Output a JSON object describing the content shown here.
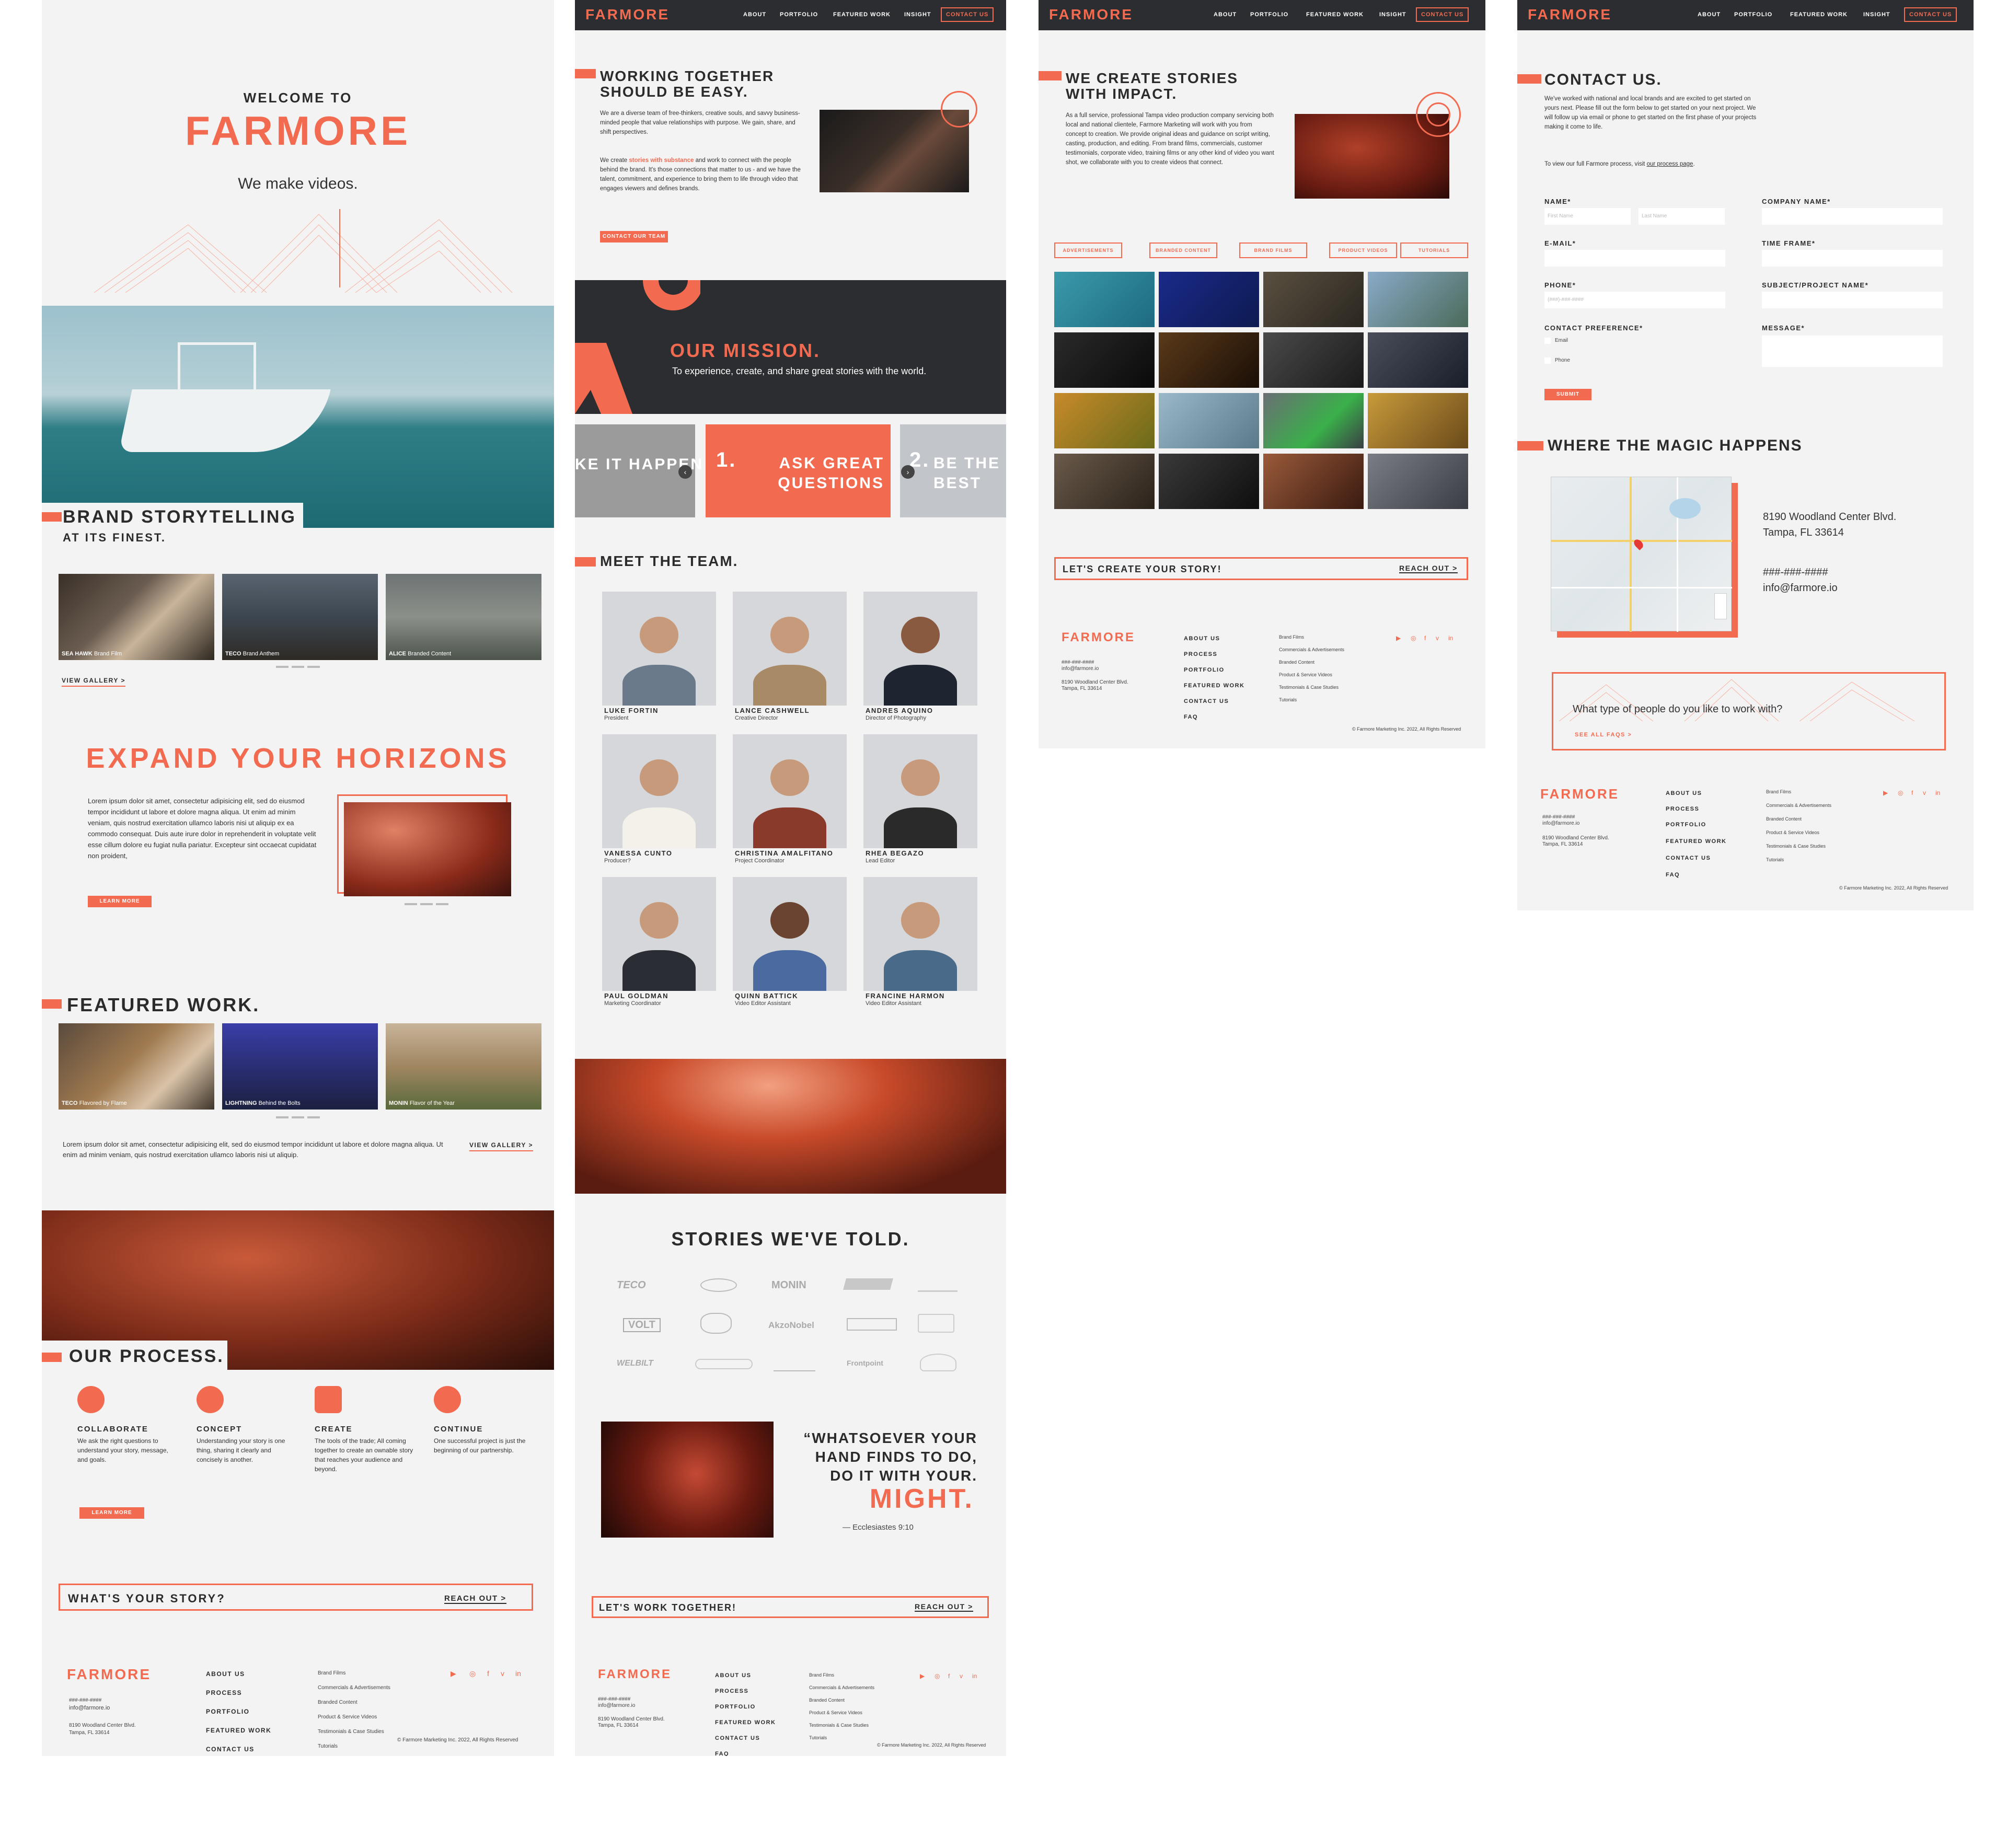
{
  "brand": "FARMORE",
  "colors": {
    "accent": "#f26b50",
    "dark": "#2b2d30",
    "bg": "#f3f3f3"
  },
  "nav": {
    "about": "ABOUT",
    "portfolio": "PORTFOLIO",
    "featured": "FEATURED WORK",
    "insight": "INSIGHT",
    "contact": "CONTACT US"
  },
  "home": {
    "welcome": "WELCOME TO",
    "tagline": "We make videos.",
    "brand_title_1": "BRAND STORYTELLING",
    "brand_title_2": "AT ITS FINEST.",
    "films": [
      {
        "name": "SEA HAWK",
        "type": "Brand Film"
      },
      {
        "name": "TECO",
        "type": "Brand Anthem"
      },
      {
        "name": "ALICE",
        "type": "Branded Content"
      }
    ],
    "view_gallery": "VIEW GALLERY >",
    "expand": "EXPAND YOUR HORIZONS",
    "lorem": "Lorem ipsum dolor sit amet, consectetur adipisicing elit, sed do eiusmod tempor incididunt ut labore et dolore magna aliqua. Ut enim ad minim veniam, quis nostrud exercitation ullamco laboris nisi ut aliquip ex ea commodo consequat. Duis aute irure dolor in reprehenderit in voluptate velit esse cillum dolore eu fugiat nulla pariatur. Excepteur sint occaecat cupidatat non proident,",
    "learn_more": "LEARN MORE",
    "featured_title": "FEATURED WORK.",
    "featured": [
      {
        "name": "TECO",
        "type": "Flavored by Flame"
      },
      {
        "name": "LIGHTNING",
        "type": "Behind the Bolts"
      },
      {
        "name": "MONIN",
        "type": "Flavor of the Year"
      }
    ],
    "featured_text": "Lorem ipsum dolor sit amet, consectetur adipisicing elit, sed do eiusmod tempor incididunt ut labore et dolore magna aliqua. Ut enim ad minim veniam, quis nostrud exercitation ullamco laboris nisi ut aliquip.",
    "view_gallery2": "VIEW GALLERY >",
    "process_title": "OUR PROCESS.",
    "process": [
      {
        "t": "COLLABORATE",
        "d": "We ask the right questions to understand your story, message, and goals."
      },
      {
        "t": "CONCEPT",
        "d": "Understanding your story is one thing, sharing it clearly and concisely is another."
      },
      {
        "t": "CREATE",
        "d": "The tools of the trade; All coming together to create an ownable story that reaches your audience and beyond."
      },
      {
        "t": "CONTINUE",
        "d": "One successful project is just the beginning of our partnership."
      }
    ],
    "learn_more2": "LEARN MORE",
    "story_cta": "WHAT'S YOUR STORY?",
    "reach_out": "REACH OUT >"
  },
  "about": {
    "title_1": "WORKING TOGETHER",
    "title_2": "SHOULD BE EASY.",
    "p1": "We are a diverse team of free-thinkers, creative souls, and savvy business-minded people that value relationships with purpose. We gain, share, and shift perspectives.",
    "p2a": "We create ",
    "p2b": "stories with substance",
    "p2c": " and work to connect with the people behind the brand. It's those connections that matter to us - and we have the talent, commitment, and experience to bring them to life through video that engages viewers and defines brands.",
    "contact_team": "CONTACT OUR TEAM",
    "mission_title": "OUR MISSION.",
    "mission_text": "To experience, create, and share great stories with the world.",
    "slide_prev": "KE IT HAPPEN",
    "slide_main_num": "1.",
    "slide_main": "ASK GREAT QUESTIONS",
    "slide_next_num": "2.",
    "slide_next": "BE THE BEST",
    "team_title": "MEET THE TEAM.",
    "team": [
      {
        "n": "LUKE FORTIN",
        "r": "President"
      },
      {
        "n": "LANCE CASHWELL",
        "r": "Creative Director"
      },
      {
        "n": "ANDRES AQUINO",
        "r": "Director of Photography"
      },
      {
        "n": "VANESSA CUNTO",
        "r": "Producer?"
      },
      {
        "n": "CHRISTINA AMALFITANO",
        "r": "Project Coordinator"
      },
      {
        "n": "RHEA BEGAZO",
        "r": "Lead Editor"
      },
      {
        "n": "PAUL GOLDMAN",
        "r": "Marketing Coordinator"
      },
      {
        "n": "QUINN BATTICK",
        "r": "Video Editor Assistant"
      },
      {
        "n": "FRANCINE HARMON",
        "r": "Video Editor Assistant"
      }
    ],
    "stories_title": "STORIES WE'VE TOLD.",
    "logos": [
      "TECO",
      "",
      "MONIN",
      "",
      "",
      "VOLT",
      "",
      "AkzoNobel",
      "",
      "",
      "WELBILT",
      "",
      "",
      "Frontpoint",
      ""
    ],
    "quote_1": "“WHATSOEVER YOUR",
    "quote_2": "HAND FINDS TO DO,",
    "quote_3": "DO IT WITH YOUR.",
    "quote_might": "MIGHT.",
    "quote_src": "— Ecclesiastes 9:10",
    "cta": "LET'S WORK TOGETHER!",
    "reach_out": "REACH OUT >"
  },
  "portfolio": {
    "title_1": "WE CREATE STORIES",
    "title_2": "WITH IMPACT.",
    "text": "As a full service, professional Tampa video production company servicing both local and national clientele, Farmore Marketing will work with you from concept to creation. We provide original ideas and guidance on script writing, casting, production, and editing. From brand films, commercials, customer testimonials, corporate video, training films or any other kind of video you want shot, we collaborate with you to create videos that connect.",
    "tags": [
      "ADVERTISEMENTS",
      "BRANDED CONTENT",
      "BRAND FILMS",
      "PRODUCT VIDEOS",
      "TUTORIALS"
    ],
    "cta": "LET'S CREATE YOUR STORY!",
    "reach_out": "REACH OUT >"
  },
  "contact": {
    "title": "CONTACT US.",
    "p1": "We've worked with national and local brands and are excited to get started on yours next. Please fill out the form below to get started on your next project. We will follow up via email or phone to get started on the first phase of your projects making it come to life.",
    "p2a": "To view our full Farmore process, visit ",
    "p2b": "our process page",
    "p2c": ".",
    "name": "NAME*",
    "first": "First Name",
    "last": "Last Name",
    "company": "COMPANY NAME*",
    "email": "E-MAIL*",
    "time": "TIME FRAME*",
    "phone": "PHONE*",
    "phone_ph": "(###)-###-####",
    "subject": "SUBJECT/PROJECT NAME*",
    "pref": "CONTACT PREFERENCE*",
    "pref_email": "Email",
    "pref_phone": "Phone",
    "message": "MESSAGE*",
    "submit": "SUBMIT",
    "magic": "WHERE THE MAGIC HAPPENS",
    "addr1": "8190 Woodland Center Blvd.",
    "addr2": "Tampa, FL 33614",
    "phone_num": "###-###-####",
    "email_addr": "info@farmore.io",
    "faq_q": "What type of people do you like to work with?",
    "faq_link": "SEE ALL FAQS >"
  },
  "footer": {
    "phone": "###-###-####",
    "email": "info@farmore.io",
    "addr1": "8190 Woodland Center Blvd.",
    "addr2": "Tampa, FL 33614",
    "links": [
      "ABOUT US",
      "PROCESS",
      "PORTFOLIO",
      "FEATURED WORK",
      "CONTACT US",
      "FAQ"
    ],
    "services": [
      "Brand Films",
      "Commercials & Advertisements",
      "Branded Content",
      "Product & Service Videos",
      "Testimonials & Case Studies",
      "Tutorials"
    ],
    "social": [
      "▶",
      "◎",
      "f",
      "v",
      "in"
    ],
    "copyright": "© Farmore Marketing Inc. 2022, All Rights Reserved"
  }
}
